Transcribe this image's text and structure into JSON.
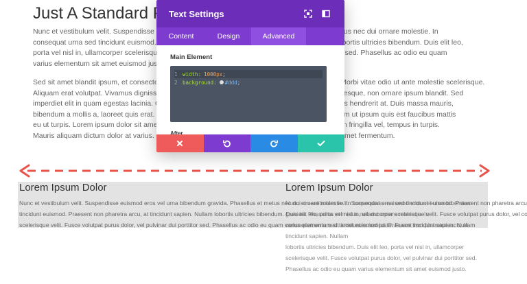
{
  "page": {
    "title": "Just A Standard P",
    "para1": [
      "Nunc et vestibulum velit. Suspendisse euismod eros vel urna bibendum gravida. Phasellus et metus nec dui ornare molestie. In",
      "consequat urna sed tincidunt euismod. Praesent non pharetra arcu, at tincidunt sapien. Nullam lobortis ultricies bibendum. Duis elit leo,",
      "porta vel nisl in, ullamcorper scelerisque velit. Fusce volutpat purus dolor, vel pulvinar dui porttitor sed. Phasellus ac odio eu quam",
      "varius elementum sit amet euismod justo."
    ],
    "para2": [
      "Sed sit amet blandit ipsum, et consectetur augue. Nullam sodales, ipsum vel consequat ultrices. Morbi vitae odio ut ante molestie scelerisque.",
      "Aliquam erat volutpat. Vivamus dignissim leo vel nibh fermentum. Nulla facilisi. Sed lacinia pellentesque, non ornare ipsum blandit. Sed",
      "imperdiet elit in quam egestas lacinia. Cras placerat dapibus elit. Morbi at luctus nisi, a luctus tellus hendrerit at. Duis massa mauris,",
      "bibendum a mollis a, laoreet quis erat. Donec pretium lacus at tellus finibus, at malesuada vel. Nam ut ipsum quis est faucibus mattis",
      "eu ut turpis. Lorem ipsum dolor sit amet, consectetur adipiscing elit. Donec dui neque, venenatis in fringilla vel, tempus in turpis.",
      "Mauris aliquam dictum dolor at varius. Cras et quam risus. Sed venenatis lectus ultrices nulla sit amet fermentum."
    ]
  },
  "blocks": {
    "left_title": "Lorem Ipsum Dolor",
    "right_title": "Lorem Ipsum Dolor",
    "left_lines": [
      "Nunc et vestibulum velit. Suspendisse euismod eros vel urna bibendum gravida. Phasellus et metus nec dui ornare molestie. In consequat urna sed tincidunt euismod. Praesent non pharetra arcu, at bibendum",
      "tincidunt euismod. Praesent non pharetra arcu, at tincidunt sapien. Nullam lobortis ultricies bibendum. Duis elit leo, porta vel nisl in, ullamcorper scelerisque velit. Fusce volutpat purus dolor, vel consequat urna sed",
      "scelerisque velit. Fusce volutpat purus dolor, vel pulvinar dui porttitor sed. Phasellus ac odio eu quam varius elementum sit amet euismod justo. Fusce tincidunt sapien. Nullam"
    ],
    "right_lines": [
      "Nunc et vestibulum velit. Suspendisse euismod eros vel urna bibendum",
      "gravida. Phasellus et metus nec dui ornare molestie. In",
      "consequat urna sed tincidunt euismod. Praesent non pharetra arcu, at",
      "tincidunt sapien. Nullam",
      "lobortis ultricies bibendum. Duis elit leo, porta vel nisl in, ullamcorper",
      "scelerisque velit. Fusce volutpat purus dolor, vel pulvinar dui porttitor sed.",
      "Phasellus ac odio eu quam varius elementum sit amet euismod justo."
    ]
  },
  "modal": {
    "title": "Text Settings",
    "tabs": [
      "Content",
      "Design",
      "Advanced"
    ],
    "active_tab": "Advanced",
    "section_label": "Main Element",
    "code": {
      "line1_no": "1",
      "line1_prop": "width:",
      "line1_val": "1000px",
      "line1_end": ";",
      "line2_no": "2",
      "line2_prop": "background:",
      "line2_val": "#ddd",
      "line2_end": ";"
    },
    "after_label": "After",
    "actions": [
      "cancel",
      "undo",
      "redo",
      "save"
    ],
    "colors": {
      "header": "#6c2eb9",
      "tabs": "#7d3bd0",
      "cancel": "#ef5b5b",
      "undo": "#7e3bd0",
      "redo": "#2a8be4",
      "save": "#29c4a9"
    }
  },
  "arrow_color": "#e8534a"
}
